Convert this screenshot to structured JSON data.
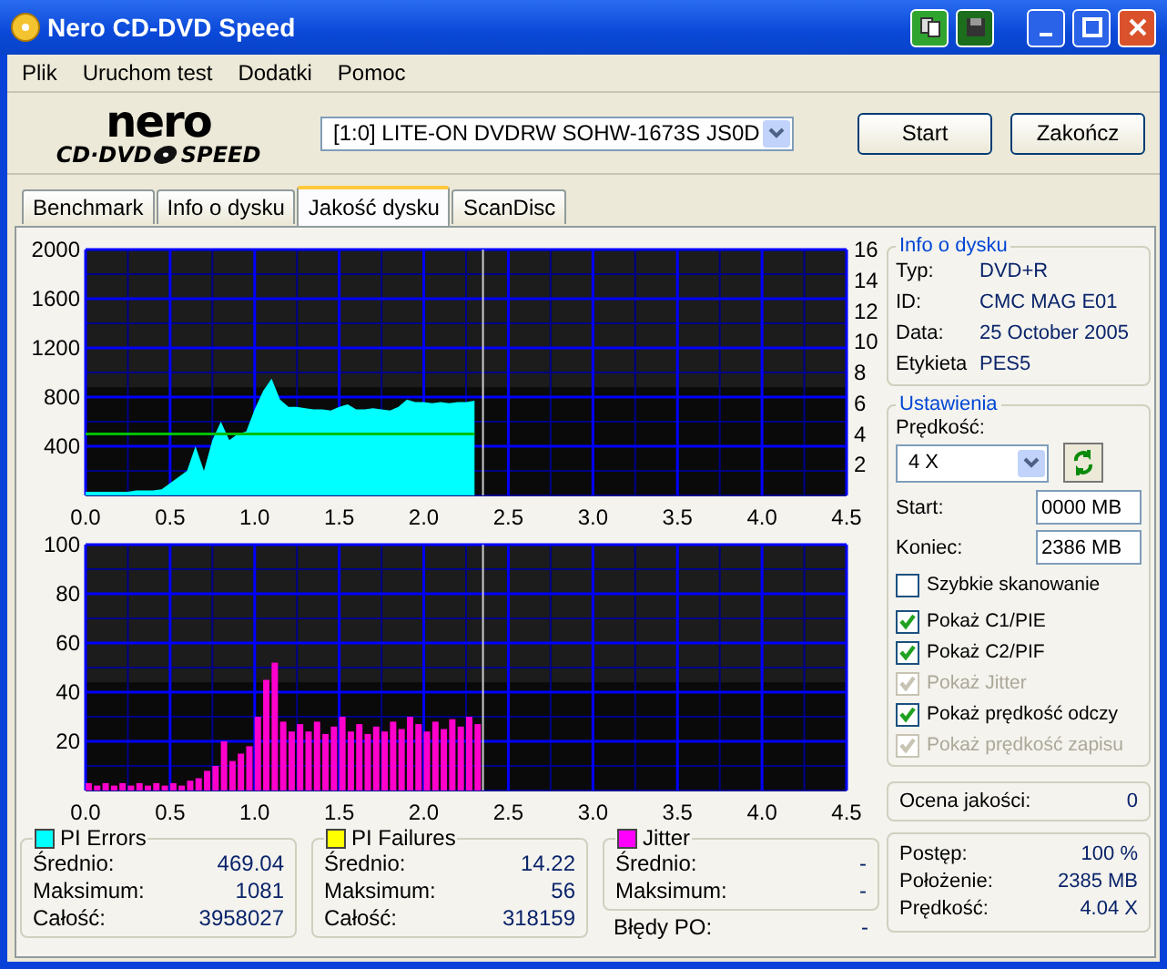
{
  "window": {
    "title": "Nero CD-DVD Speed"
  },
  "menu": [
    "Plik",
    "Uruchom test",
    "Dodatki",
    "Pomoc"
  ],
  "logo": {
    "top": "nero",
    "bottom_left": "CD·DVD",
    "bottom_right": "SPEED"
  },
  "toolbar": {
    "drive": "[1:0]  LITE-ON DVDRW SOHW-1673S JS0D",
    "buttons": [
      "Start",
      "Zakończ"
    ]
  },
  "tabs": [
    {
      "label": "Benchmark",
      "selected": false
    },
    {
      "label": "Info o dysku",
      "selected": false
    },
    {
      "label": "Jakość dysku",
      "selected": true
    },
    {
      "label": "ScanDisc",
      "selected": false
    }
  ],
  "charts": [
    {
      "chart_data": {
        "type": "area",
        "grid": true,
        "x": [
          0,
          0.05,
          0.1,
          0.15,
          0.2,
          0.25,
          0.3,
          0.35,
          0.4,
          0.45,
          0.5,
          0.55,
          0.6,
          0.65,
          0.7,
          0.75,
          0.8,
          0.85,
          0.9,
          0.95,
          1.0,
          1.05,
          1.1,
          1.15,
          1.2,
          1.25,
          1.3,
          1.35,
          1.4,
          1.45,
          1.5,
          1.55,
          1.6,
          1.65,
          1.7,
          1.75,
          1.8,
          1.85,
          1.9,
          1.95,
          2.0,
          2.05,
          2.1,
          2.15,
          2.2,
          2.25,
          2.3
        ],
        "xlim": [
          0,
          4.5
        ],
        "ylim": [
          0,
          2000
        ],
        "xticks": [
          {
            "value": 0,
            "label": "0.0"
          },
          {
            "value": 0.5,
            "label": "0.5"
          },
          {
            "value": 1,
            "label": "1.0"
          },
          {
            "value": 1.5,
            "label": "1.5"
          },
          {
            "value": 2,
            "label": "2.0"
          },
          {
            "value": 2.5,
            "label": "2.5"
          },
          {
            "value": 3,
            "label": "3.0"
          },
          {
            "value": 3.5,
            "label": "3.5"
          },
          {
            "value": 4,
            "label": "4.0"
          },
          {
            "value": 4.5,
            "label": "4.5"
          }
        ],
        "yticks": [
          400,
          800,
          1200,
          1600,
          2000
        ],
        "bands": [
          {
            "axis": "y",
            "from": 880,
            "to": 2000
          }
        ],
        "ref_lines": [
          {
            "axis": "x",
            "value": 2.35
          }
        ],
        "y2lim": [
          0,
          16
        ],
        "y2ticks": [
          2,
          4,
          6,
          8,
          10,
          12,
          14,
          16
        ],
        "series": [
          {
            "color": "#00ffff",
            "values": [
              30,
              30,
              30,
              30,
              30,
              30,
              40,
              40,
              40,
              50,
              100,
              150,
              200,
              400,
              200,
              450,
              600,
              450,
              500,
              520,
              700,
              850,
              950,
              780,
              720,
              720,
              710,
              700,
              700,
              690,
              720,
              740,
              700,
              700,
              710,
              700,
              690,
              720,
              780,
              760,
              760,
              750,
              760,
              750,
              760,
              760,
              770
            ]
          },
          {
            "color": "#00c000",
            "axis": "y2",
            "type": "line",
            "values": [
              4,
              4,
              4,
              4,
              4,
              4,
              4,
              4,
              4,
              4,
              4,
              4,
              4,
              4,
              4,
              4,
              4,
              4,
              4,
              4,
              4,
              4,
              4,
              4,
              4,
              4,
              4,
              4,
              4,
              4,
              4,
              4,
              4,
              4,
              4,
              4,
              4,
              4,
              4,
              4,
              4,
              4,
              4,
              4,
              4,
              4,
              4
            ]
          }
        ]
      }
    },
    {
      "chart_data": {
        "type": "bar",
        "grid": true,
        "x": [
          0,
          0.05,
          0.1,
          0.15,
          0.2,
          0.25,
          0.3,
          0.35,
          0.4,
          0.45,
          0.5,
          0.55,
          0.6,
          0.65,
          0.7,
          0.75,
          0.8,
          0.85,
          0.9,
          0.95,
          1.0,
          1.05,
          1.1,
          1.15,
          1.2,
          1.25,
          1.3,
          1.35,
          1.4,
          1.45,
          1.5,
          1.55,
          1.6,
          1.65,
          1.7,
          1.75,
          1.8,
          1.85,
          1.9,
          1.95,
          2.0,
          2.05,
          2.1,
          2.15,
          2.2,
          2.25,
          2.3
        ],
        "xlim": [
          0,
          4.5
        ],
        "ylim": [
          0,
          100
        ],
        "xticks": [
          {
            "value": 0,
            "label": "0.0"
          },
          {
            "value": 0.5,
            "label": "0.5"
          },
          {
            "value": 1,
            "label": "1.0"
          },
          {
            "value": 1.5,
            "label": "1.5"
          },
          {
            "value": 2,
            "label": "2.0"
          },
          {
            "value": 2.5,
            "label": "2.5"
          },
          {
            "value": 3,
            "label": "3.0"
          },
          {
            "value": 3.5,
            "label": "3.5"
          },
          {
            "value": 4,
            "label": "4.0"
          },
          {
            "value": 4.5,
            "label": "4.5"
          }
        ],
        "yticks": [
          20,
          40,
          60,
          80,
          100
        ],
        "bands": [
          {
            "axis": "y",
            "from": 44,
            "to": 100
          }
        ],
        "ref_lines": [
          {
            "axis": "x",
            "value": 2.35
          }
        ],
        "series": [
          {
            "color": "#ff00cc",
            "values": [
              3,
              2,
              3,
              2,
              3,
              2,
              3,
              2,
              3,
              2,
              3,
              2,
              4,
              5,
              8,
              10,
              20,
              12,
              15,
              18,
              30,
              45,
              52,
              28,
              24,
              27,
              24,
              28,
              23,
              26,
              30,
              24,
              27,
              23,
              26,
              24,
              28,
              25,
              30,
              27,
              24,
              28,
              25,
              29,
              26,
              30,
              27
            ]
          }
        ]
      }
    }
  ],
  "disc_info": {
    "title": "Info o dysku",
    "fields": [
      {
        "label": "Typ:",
        "value": "DVD+R"
      },
      {
        "label": "ID:",
        "value": "CMC MAG E01"
      },
      {
        "label": "Data:",
        "value": "25 October 2005"
      },
      {
        "label": "Etykieta",
        "value": "PES5"
      }
    ]
  },
  "settings": {
    "title": "Ustawienia",
    "speed_label": "Prędkość:",
    "speed_value": "4 X",
    "start_label": "Start:",
    "start_value": "0000 MB",
    "end_label": "Koniec:",
    "end_value": "2386 MB",
    "options": [
      {
        "label": "Szybkie skanowanie",
        "checked": false,
        "disabled": false
      },
      {
        "label": "Pokaż C1/PIE",
        "checked": true,
        "disabled": false
      },
      {
        "label": "Pokaż C2/PIF",
        "checked": true,
        "disabled": false
      },
      {
        "label": "Pokaż Jitter",
        "checked": true,
        "disabled": true
      },
      {
        "label": "Pokaż prędkość odczy",
        "checked": true,
        "disabled": false
      },
      {
        "label": "Pokaż prędkość zapisu",
        "checked": true,
        "disabled": true
      }
    ]
  },
  "quality": {
    "label": "Ocena jakości:",
    "value": "0"
  },
  "stats": [
    {
      "title": "PI Errors",
      "color": "#00ffff",
      "rows": [
        {
          "label": "Średnio:",
          "value": "469.04"
        },
        {
          "label": "Maksimum:",
          "value": "1081"
        },
        {
          "label": "Całość:",
          "value": "3958027"
        }
      ]
    },
    {
      "title": "PI Failures",
      "color": "#ffff00",
      "rows": [
        {
          "label": "Średnio:",
          "value": "14.22"
        },
        {
          "label": "Maksimum:",
          "value": "56"
        },
        {
          "label": "Całość:",
          "value": "318159"
        }
      ]
    },
    {
      "title": "Jitter",
      "color": "#ff00ff",
      "rows": [
        {
          "label": "Średnio:",
          "value": "-"
        },
        {
          "label": "Maksimum:",
          "value": "-"
        }
      ]
    }
  ],
  "po_errors": {
    "label": "Błędy PO:",
    "value": "-"
  },
  "progress": [
    {
      "label": "Postęp:",
      "value": "100 %"
    },
    {
      "label": "Położenie:",
      "value": "2385 MB"
    },
    {
      "label": "Prędkość:",
      "value": "4.04 X"
    }
  ]
}
